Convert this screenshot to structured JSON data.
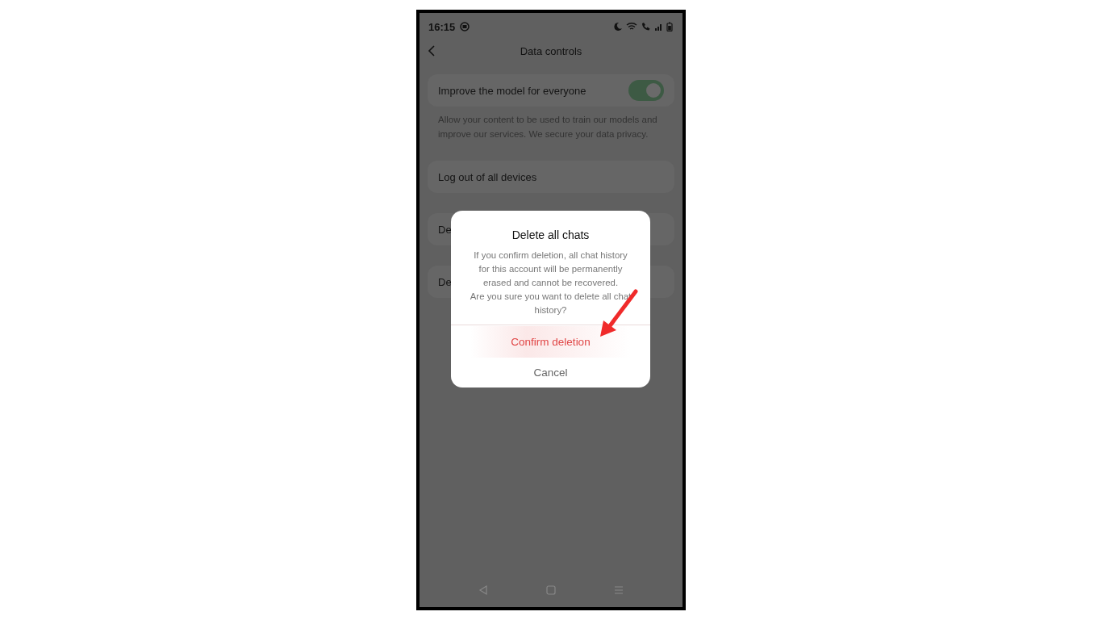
{
  "status_bar": {
    "time": "16:15"
  },
  "header": {
    "title": "Data controls"
  },
  "settings": [
    {
      "kind": "toggle",
      "label": "Improve the model for everyone",
      "on": true,
      "description": "Allow your content to be used to train our models and improve our services. We secure your data privacy."
    },
    {
      "kind": "action",
      "label": "Log out of all devices"
    },
    {
      "kind": "action",
      "label": "De"
    },
    {
      "kind": "action",
      "label": "De"
    }
  ],
  "dialog": {
    "title": "Delete all chats",
    "message": "If you confirm deletion, all chat history for this account will be permanently erased and cannot be recovered.\nAre you sure you want to delete all chat history?",
    "buttons": [
      {
        "label": "Confirm deletion",
        "kind": "destructive"
      },
      {
        "label": "Cancel",
        "kind": "normal"
      }
    ]
  }
}
